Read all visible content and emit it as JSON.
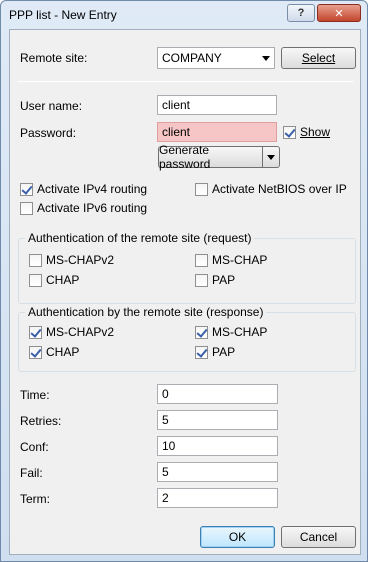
{
  "window": {
    "title": "PPP list - New Entry",
    "help_glyph": "?",
    "close_glyph": "✕"
  },
  "remote_site": {
    "label": "Remote site:",
    "value": "COMPANY",
    "select_button": "Select"
  },
  "user_name": {
    "label": "User name:",
    "value": "client"
  },
  "password": {
    "label": "Password:",
    "value": "client",
    "show_label": "Show",
    "show_checked": true,
    "generate_button": "Generate password"
  },
  "routing": {
    "ipv4": {
      "label": "Activate IPv4 routing",
      "checked": true
    },
    "ipv6": {
      "label": "Activate IPv6 routing",
      "checked": false
    },
    "netbios": {
      "label": "Activate NetBIOS over IP",
      "checked": false
    }
  },
  "auth_request": {
    "title": "Authentication of the remote site (request)",
    "options": [
      {
        "label": "MS-CHAPv2",
        "checked": false
      },
      {
        "label": "MS-CHAP",
        "checked": false
      },
      {
        "label": "CHAP",
        "checked": false
      },
      {
        "label": "PAP",
        "checked": false
      }
    ]
  },
  "auth_response": {
    "title": "Authentication by the remote site (response)",
    "options": [
      {
        "label": "MS-CHAPv2",
        "checked": true
      },
      {
        "label": "MS-CHAP",
        "checked": true
      },
      {
        "label": "CHAP",
        "checked": true
      },
      {
        "label": "PAP",
        "checked": true
      }
    ]
  },
  "timers": [
    {
      "label": "Time:",
      "value": "0"
    },
    {
      "label": "Retries:",
      "value": "5"
    },
    {
      "label": "Conf:",
      "value": "10"
    },
    {
      "label": "Fail:",
      "value": "5"
    },
    {
      "label": "Term:",
      "value": "2"
    }
  ],
  "buttons": {
    "ok": "OK",
    "cancel": "Cancel"
  }
}
